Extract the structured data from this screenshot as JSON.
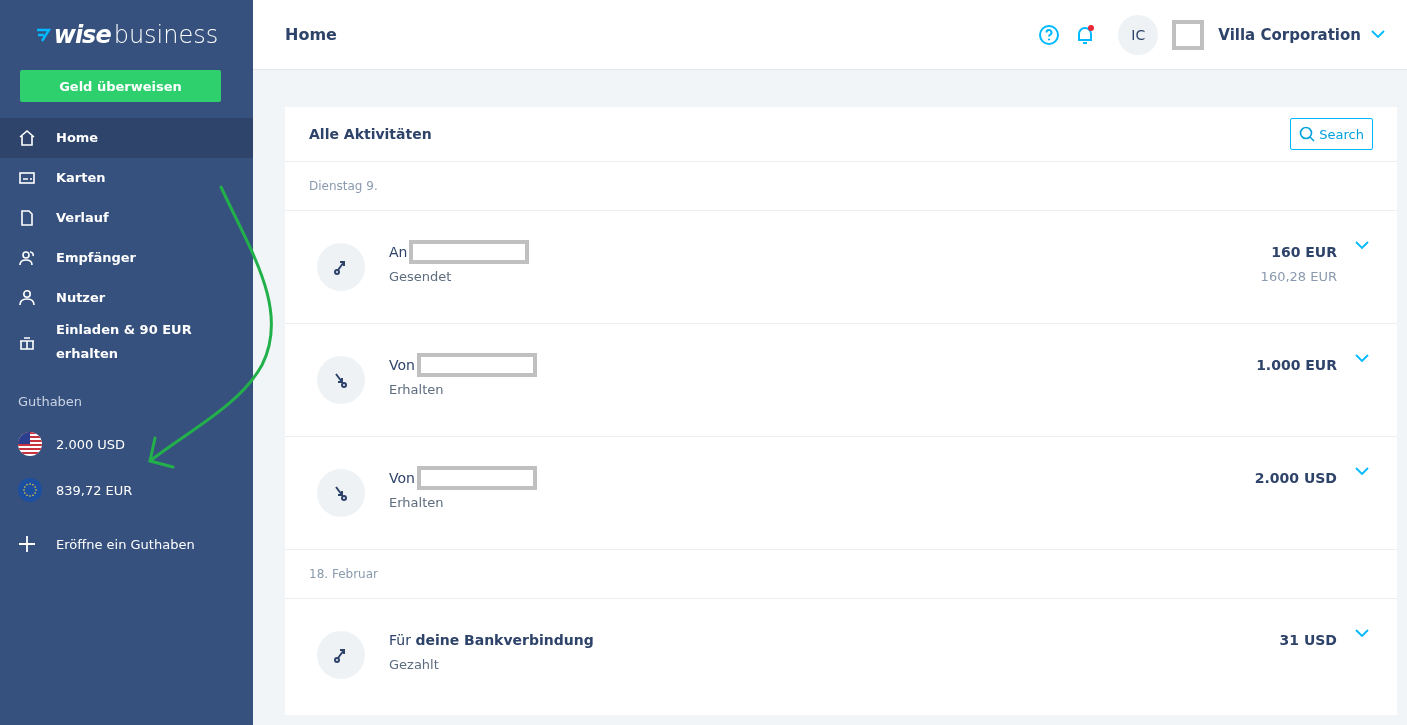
{
  "logo": {
    "brand": "wise",
    "suffix": "business"
  },
  "send_button": "Geld überweisen",
  "sidebar": {
    "items": [
      {
        "label": "Home",
        "selected": true
      },
      {
        "label": "Karten",
        "selected": false
      },
      {
        "label": "Verlauf",
        "selected": false
      },
      {
        "label": "Empfänger",
        "selected": false
      },
      {
        "label": "Nutzer",
        "selected": false
      },
      {
        "label": "Einladen & 90 EUR erhalten",
        "selected": false
      }
    ],
    "balances_heading": "Guthaben",
    "balances": [
      {
        "amount": "2.000 USD",
        "kind": "usd"
      },
      {
        "amount": "839,72 EUR",
        "kind": "eur"
      }
    ],
    "open_balance": "Eröffne ein Guthaben"
  },
  "header": {
    "title": "Home",
    "notification_unread": true,
    "avatar_initials": "IC",
    "account_name": "Villa Corporation"
  },
  "activity": {
    "title": "Alle Aktivitäten",
    "search_button": "Search",
    "groups": [
      {
        "date": "Dienstag 9.",
        "rows": [
          {
            "kind": "sent",
            "title": "An",
            "redacted": true,
            "status": "Gesendet",
            "amount": "160 EUR",
            "sub_amount": "160,28 EUR"
          },
          {
            "kind": "received",
            "title": "Von",
            "redacted": true,
            "status": "Erhalten",
            "amount": "1.000 EUR"
          },
          {
            "kind": "received",
            "title": "Von",
            "redacted": true,
            "status": "Erhalten",
            "amount": "2.000 USD"
          }
        ]
      },
      {
        "date": "18. Februar",
        "rows": [
          {
            "kind": "sent",
            "title": "Für **deine Bankverbindung**",
            "redacted": false,
            "status": "Gezahlt",
            "amount": "31 USD"
          }
        ]
      }
    ]
  },
  "annotation": {
    "arrow": true
  }
}
